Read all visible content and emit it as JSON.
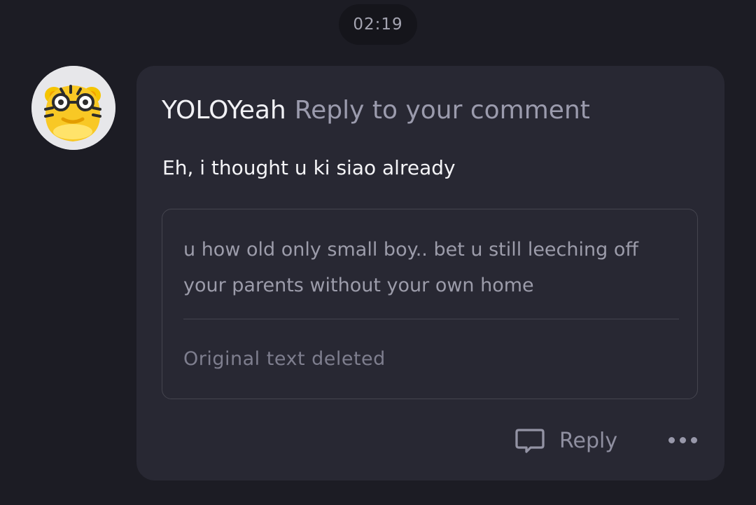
{
  "timestamp": "02:19",
  "comment": {
    "username": "YOLOYeah",
    "action": "Reply to your comment",
    "message": "Eh, i thought u ki siao already",
    "quoted_text": "u how old only small boy.. bet u still leeching off your parents without your own home",
    "quoted_status": "Original text deleted",
    "reply_label": "Reply",
    "avatar_icon": "tiger-avatar-icon",
    "reply_icon": "chat-bubble-icon",
    "more_icon": "more-dots-icon"
  },
  "colors": {
    "background": "#1c1c24",
    "card": "#282833",
    "accent": "#f8c825"
  }
}
